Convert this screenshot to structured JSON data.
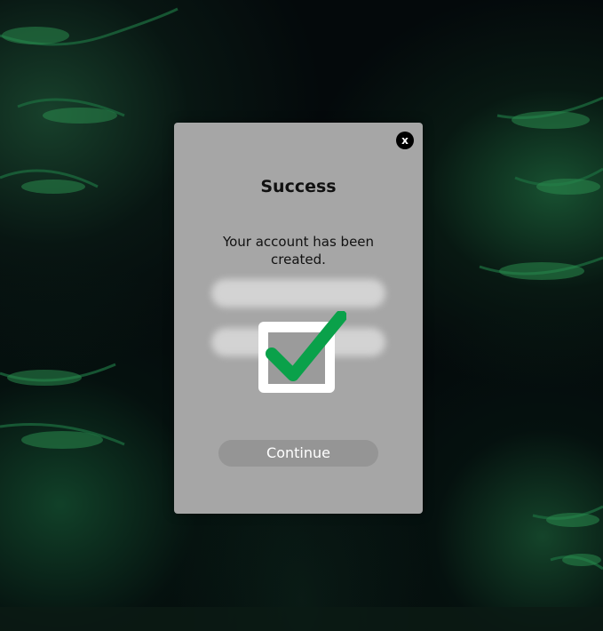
{
  "dialog": {
    "close_label": "x",
    "title": "Success",
    "message": "Your account has been created.",
    "continue_label": "Continue"
  },
  "icons": {
    "close": "close-icon",
    "success": "checkbox-checked-icon"
  },
  "colors": {
    "dialog_background": "#a6a6a6",
    "check_green": "#0aa14a",
    "button_background": "#959595",
    "page_background": "#04090b",
    "foliage_green": "#1f7a45"
  }
}
